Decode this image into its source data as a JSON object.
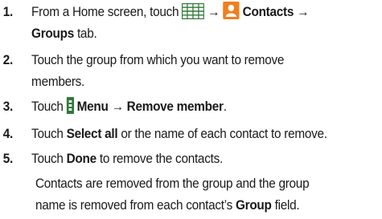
{
  "steps": [
    {
      "number": "1.",
      "lead": "From a Home screen, touch",
      "arrow1": "→",
      "contacts": "Contacts",
      "arrow2": "→",
      "groups_tab": "Groups",
      "tab_word": "tab."
    },
    {
      "number": "2.",
      "line1": "Touch the group from which you want to remove",
      "line2": "members."
    },
    {
      "number": "3.",
      "lead": "Touch",
      "menu": "Menu",
      "arrow": "→",
      "remove_member": "Remove member",
      "end": "."
    },
    {
      "number": "4.",
      "lead": "Touch",
      "select_all": "Select all",
      "rest": "or the name of each contact to remove."
    },
    {
      "number": "5.",
      "lead": "Touch",
      "done": "Done",
      "rest": "to remove the contacts."
    }
  ],
  "note": {
    "line1": "Contacts are removed from the group and the group",
    "line2_lead": "name is removed from each contact’s",
    "group": "Group",
    "line2_end": "field."
  },
  "colors": {
    "apps_icon": "#2f7a3a",
    "contacts_icon": "#f07f1f",
    "menu_icon": "#2f7a3a"
  },
  "icons": {
    "apps": "apps-grid-icon",
    "contacts": "contacts-person-icon",
    "menu": "menu-icon"
  }
}
